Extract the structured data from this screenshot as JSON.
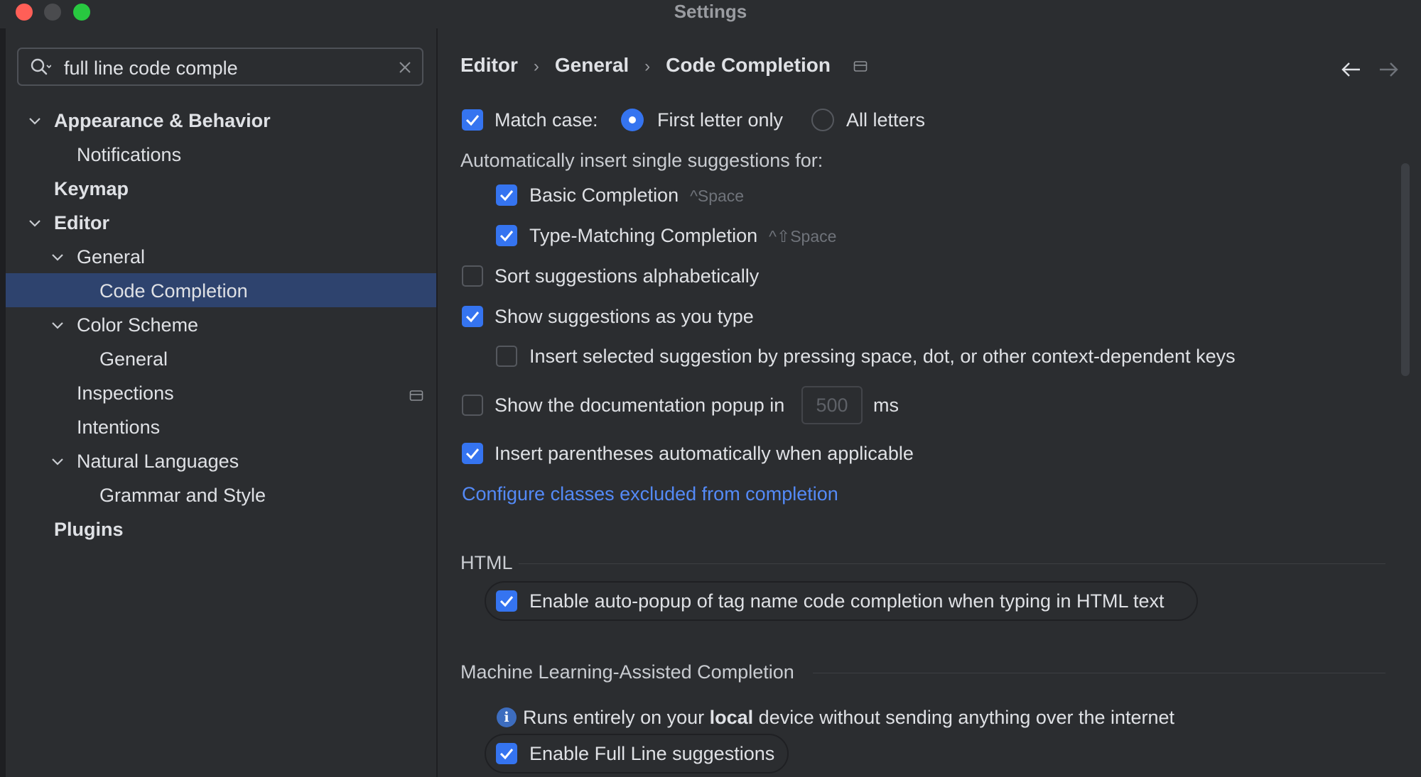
{
  "window": {
    "title": "Settings"
  },
  "search": {
    "value": "full line code comple"
  },
  "tree": {
    "appearance": "Appearance & Behavior",
    "notifications": "Notifications",
    "keymap": "Keymap",
    "editor": "Editor",
    "general": "General",
    "code_completion": "Code Completion",
    "color_scheme": "Color Scheme",
    "color_general": "General",
    "inspections": "Inspections",
    "intentions": "Intentions",
    "natural_languages": "Natural Languages",
    "grammar": "Grammar and Style",
    "plugins": "Plugins"
  },
  "breadcrumb": [
    "Editor",
    "General",
    "Code Completion"
  ],
  "settings": {
    "match_case": {
      "label": "Match case:",
      "checked": true
    },
    "first_letter": {
      "label": "First letter only",
      "selected": true
    },
    "all_letters": {
      "label": "All letters",
      "selected": false
    },
    "auto_insert_label": "Automatically insert single suggestions for:",
    "basic_completion": {
      "label": "Basic Completion",
      "shortcut": "^Space",
      "checked": true
    },
    "type_matching": {
      "label": "Type-Matching Completion",
      "shortcut": "^⇧Space",
      "checked": true
    },
    "sort_alpha": {
      "label": "Sort suggestions alphabetically",
      "checked": false
    },
    "show_as_type": {
      "label": "Show suggestions as you type",
      "checked": true
    },
    "insert_selected": {
      "label": "Insert selected suggestion by pressing space, dot, or other context-dependent keys",
      "checked": false
    },
    "doc_popup": {
      "label": "Show the documentation popup in",
      "value": "500",
      "unit": "ms",
      "checked": false
    },
    "insert_parens": {
      "label": "Insert parentheses automatically when applicable",
      "checked": true
    },
    "configure_link": "Configure classes excluded from completion"
  },
  "html_section": {
    "title": "HTML",
    "auto_popup": {
      "label": "Enable auto-popup of tag name code completion when typing in HTML text",
      "checked": true
    }
  },
  "ml_section": {
    "title": "Machine Learning-Assisted Completion",
    "info_pre": "Runs entirely on your ",
    "info_bold": "local",
    "info_post": " device without sending anything over the internet",
    "full_line": {
      "label": "Enable Full Line suggestions",
      "checked": true
    }
  },
  "colors": {
    "accent": "#3574f0",
    "selection": "#2e436e",
    "link": "#548af7",
    "background": "#2b2d30"
  }
}
